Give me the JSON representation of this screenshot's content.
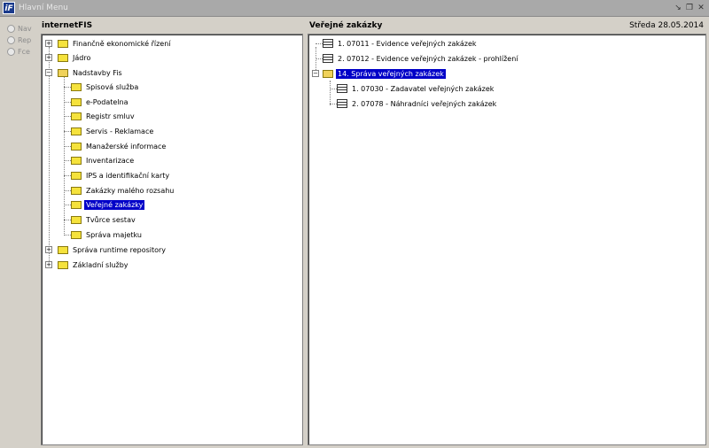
{
  "window": {
    "title": "Hlavní Menu"
  },
  "side_radios": [
    "Nav",
    "Rep",
    "Fce"
  ],
  "left_panel": {
    "header": "internetFIS",
    "nodes": [
      {
        "label": "Finančně ekonomické řízení"
      },
      {
        "label": "Jádro"
      },
      {
        "label": "Nadstavby Fis"
      },
      {
        "label": "Spisová služba"
      },
      {
        "label": "e-Podatelna"
      },
      {
        "label": "Registr smluv"
      },
      {
        "label": "Servis - Reklamace"
      },
      {
        "label": "Manažerské informace"
      },
      {
        "label": "Inventarizace"
      },
      {
        "label": "IPS a identifikační karty"
      },
      {
        "label": "Zakázky malého rozsahu"
      },
      {
        "label": "Veřejné zakázky"
      },
      {
        "label": "Tvůrce sestav"
      },
      {
        "label": "Správa majetku"
      },
      {
        "label": "Správa runtime repository"
      },
      {
        "label": "Základní služby"
      }
    ]
  },
  "right_panel": {
    "header": "Veřejné zakázky",
    "date": "Středa  28.05.2014",
    "nodes": [
      {
        "label": "1.  07011 - Evidence veřejných zakázek"
      },
      {
        "label": "2.  07012 - Evidence veřejných zakázek - prohlížení"
      },
      {
        "label": "14. Správa veřejných zakázek"
      },
      {
        "label": "1.  07030 - Zadavatel veřejných zakázek"
      },
      {
        "label": "2.  07078 - Náhradníci veřejných zakázek"
      }
    ]
  }
}
